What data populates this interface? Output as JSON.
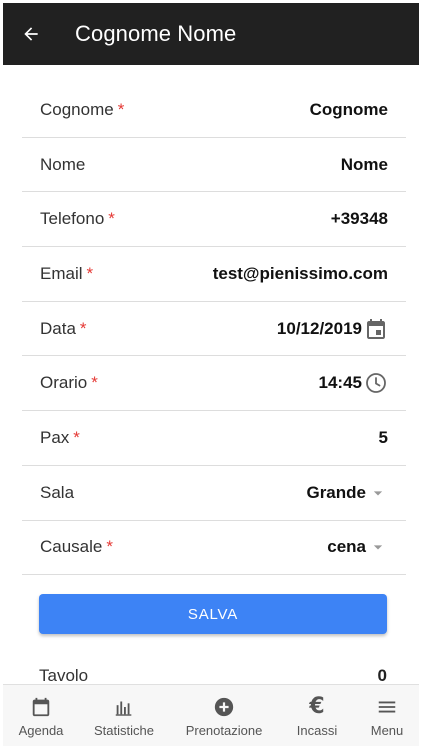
{
  "header": {
    "title": "Cognome Nome",
    "back_icon": "arrow-back-icon"
  },
  "form": {
    "fields": [
      {
        "label": "Cognome",
        "required": true,
        "value": "Cognome"
      },
      {
        "label": "Nome",
        "required": false,
        "value": "Nome"
      },
      {
        "label": "Telefono",
        "required": true,
        "value": "+39348"
      },
      {
        "label": "Email",
        "required": true,
        "value": "test@pienissimo.com"
      },
      {
        "label": "Data",
        "required": true,
        "value": "10/12/2019",
        "icon": "calendar-icon"
      },
      {
        "label": "Orario",
        "required": true,
        "value": "14:45",
        "icon": "clock-icon"
      },
      {
        "label": "Pax",
        "required": true,
        "value": "5"
      },
      {
        "label": "Sala",
        "required": false,
        "value": "Grande",
        "icon": "dropdown-arrow-icon"
      },
      {
        "label": "Causale",
        "required": true,
        "value": "cena",
        "icon": "dropdown-arrow-icon"
      }
    ],
    "required_marker": "*",
    "save_label": "SALVA",
    "tavolo": {
      "label": "Tavolo",
      "value": "0"
    }
  },
  "bottom_nav": [
    {
      "label": "Agenda",
      "icon": "calendar-icon"
    },
    {
      "label": "Statistiche",
      "icon": "bar-chart-icon"
    },
    {
      "label": "Prenotazione",
      "icon": "add-circle-icon"
    },
    {
      "label": "Incassi",
      "icon": "euro-icon"
    },
    {
      "label": "Menu",
      "icon": "hamburger-menu-icon"
    }
  ],
  "colors": {
    "appbar": "#212121",
    "primary_button": "#3d83f5",
    "required": "#e53935",
    "divider": "#dddddd",
    "bottom_nav_bg": "#f7f7f7"
  }
}
